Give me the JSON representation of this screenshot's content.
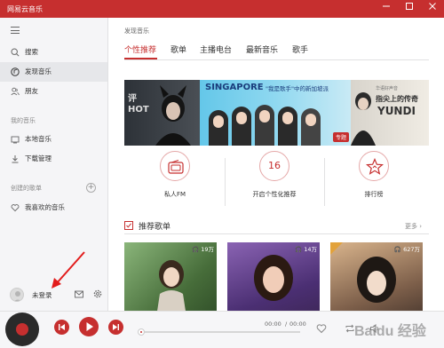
{
  "window": {
    "title": "网易云音乐",
    "controls": [
      "minimize-icon",
      "maximize-icon",
      "close-icon"
    ]
  },
  "sidebar": {
    "items": [
      {
        "label": "搜索",
        "icon": "search-icon"
      },
      {
        "label": "发现音乐",
        "icon": "music-note-icon",
        "active": true
      },
      {
        "label": "朋友",
        "icon": "friends-icon"
      }
    ],
    "section_my_music": "我的音乐",
    "my_music_items": [
      {
        "label": "本地音乐",
        "icon": "local-music-icon"
      },
      {
        "label": "下载管理",
        "icon": "download-icon"
      }
    ],
    "section_created_playlists": "创建的歌单",
    "playlist_items": [
      {
        "label": "我喜欢的音乐",
        "icon": "heart-icon"
      }
    ],
    "login_label": "未登录"
  },
  "main": {
    "breadcrumb": "发现音乐",
    "tabs": [
      {
        "label": "个性推荐",
        "active": true
      },
      {
        "label": "歌单"
      },
      {
        "label": "主播电台"
      },
      {
        "label": "最新音乐"
      },
      {
        "label": "歌手"
      }
    ],
    "banner": {
      "left_text": "HOT",
      "left_text_top": "评",
      "center_title": "SINGAPORE",
      "center_subtitle": "\"我是歌手\"中的新加坡派",
      "center_badge": "专题",
      "right_text_top": "华语好声音",
      "right_text_main": "指尖上的传奇",
      "right_text_en": "YUNDI"
    },
    "quick_links": [
      {
        "label": "私人FM",
        "icon": "radio-icon"
      },
      {
        "label": "开启个性化推荐",
        "icon": "calendar-icon",
        "icon_text": "16"
      },
      {
        "label": "排行榜",
        "icon": "star-icon"
      }
    ],
    "recommend": {
      "title": "推荐歌单",
      "more": "更多 ›",
      "playlists": [
        {
          "play_count": "19万"
        },
        {
          "play_count": "14万"
        },
        {
          "play_count": "627万"
        }
      ]
    }
  },
  "player": {
    "current_time": "00:00",
    "total_time": "00:00",
    "progress": 0
  },
  "watermark": "Baidu 经验",
  "accent_color": "#c62f2f"
}
